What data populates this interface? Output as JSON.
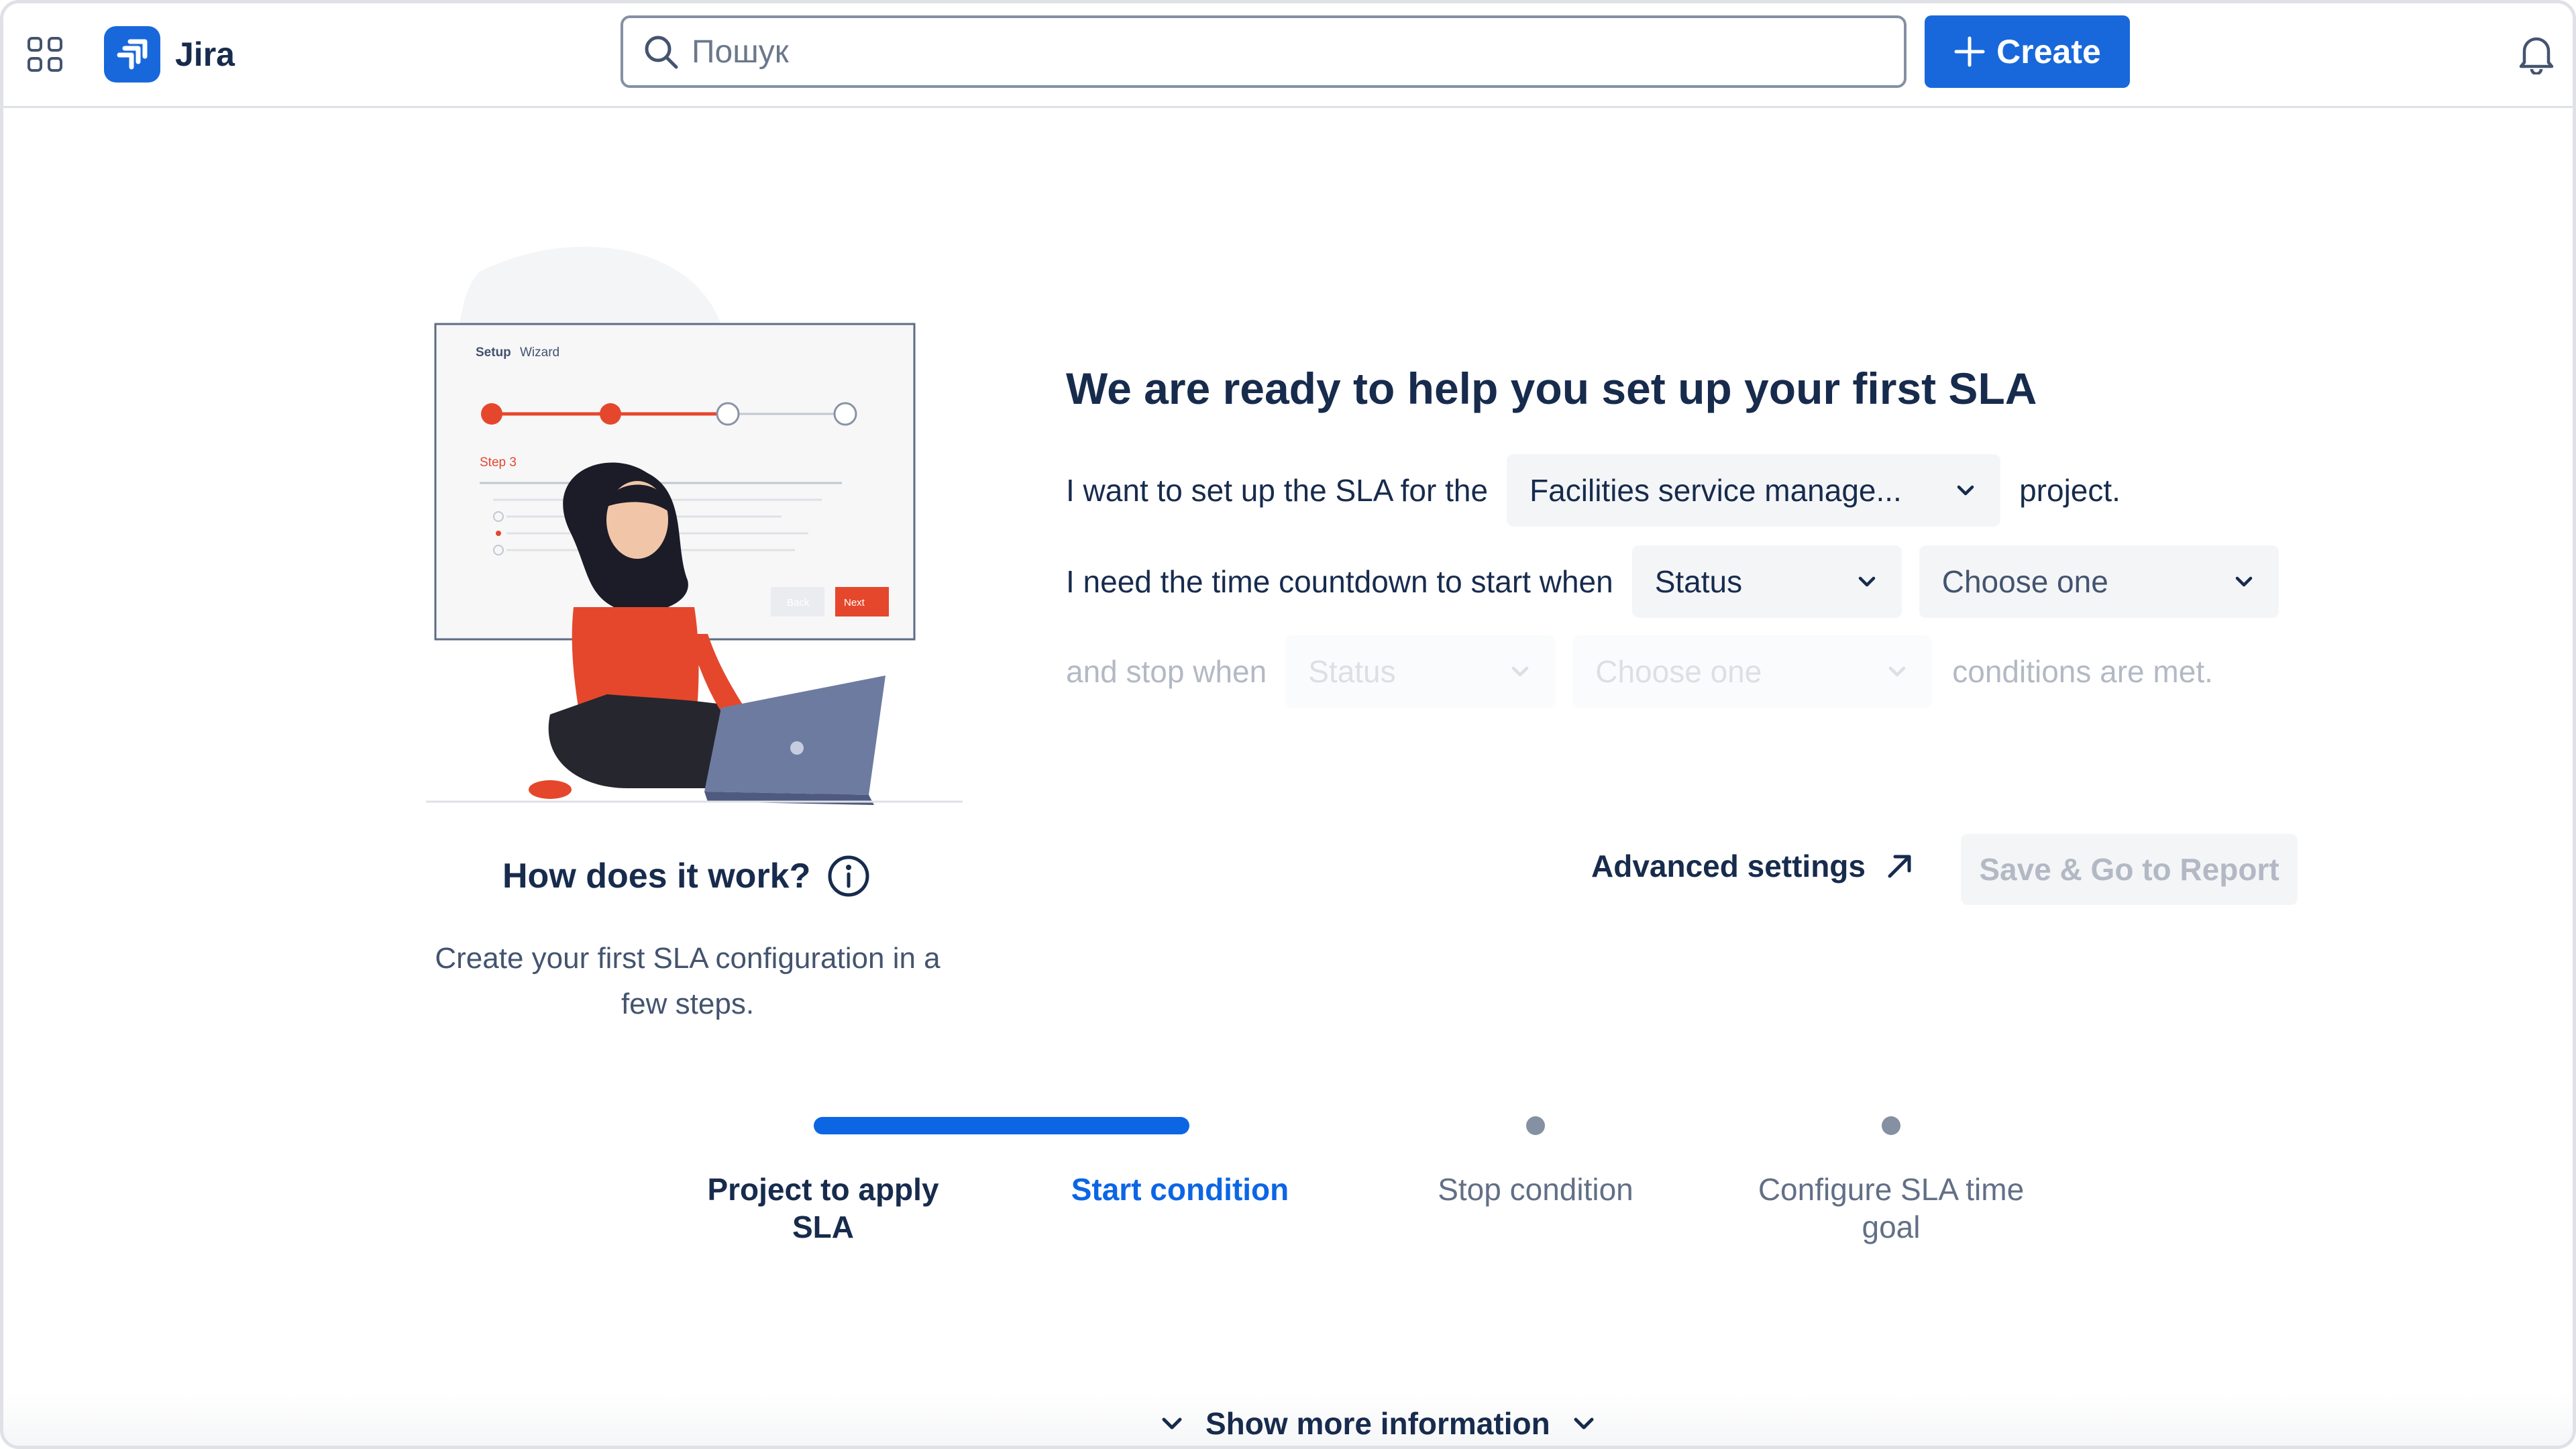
{
  "app": {
    "name": "Jira",
    "brand_color": "#1868db"
  },
  "header": {
    "search": {
      "placeholder": "Пошук"
    },
    "create_label": "Create"
  },
  "illustration": {
    "window_title_bold": "Setup",
    "window_title": "Wizard",
    "step_label": "Step 3",
    "back_label": "Back",
    "next_label": "Next",
    "accent_color": "#e5472c"
  },
  "form": {
    "heading": "We are ready to help you set up your first SLA",
    "row1": {
      "prefix": "I want to set up the SLA for the",
      "project_value": "Facilities service manage...",
      "suffix": "project."
    },
    "row2": {
      "prefix": "I need the time countdown to start when",
      "field_value": "Status",
      "condition_placeholder": "Choose one"
    },
    "row3": {
      "prefix": "and stop when",
      "field_value": "Status",
      "condition_placeholder": "Choose one",
      "suffix": "conditions are met."
    },
    "advanced_label": "Advanced settings",
    "save_label": "Save & Go to Report"
  },
  "how": {
    "title": "How does it work?",
    "description": "Create your first SLA configuration in a few steps."
  },
  "stepper": {
    "active_color": "#0c66e4",
    "steps": [
      {
        "label": "Project to apply SLA",
        "state": "done"
      },
      {
        "label": "Start condition",
        "state": "current"
      },
      {
        "label": "Stop condition",
        "state": "todo"
      },
      {
        "label": "Configure SLA time goal",
        "state": "todo"
      }
    ]
  },
  "footer": {
    "show_more_label": "Show more information"
  }
}
